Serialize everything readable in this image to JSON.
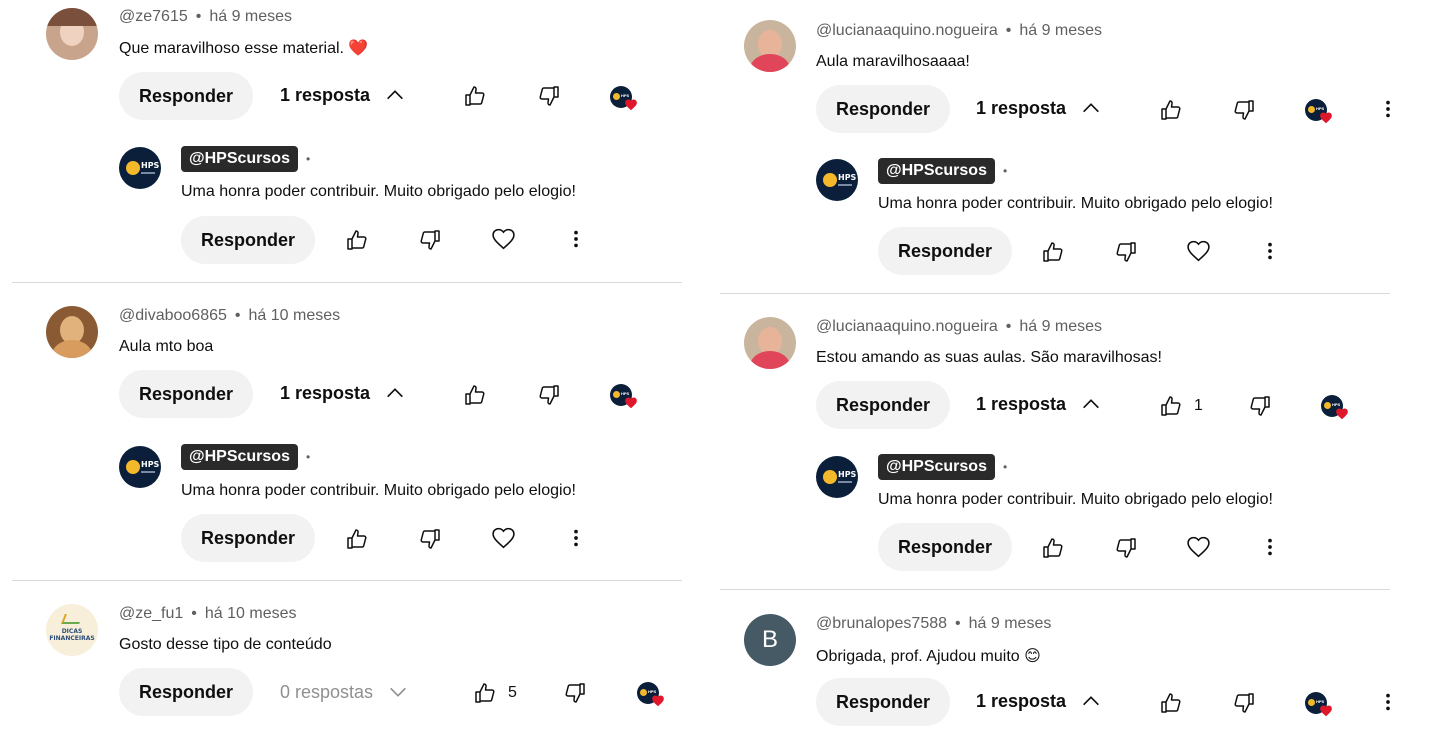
{
  "ui": {
    "reply_label": "Responder",
    "creator_handle": "@HPScursos",
    "badge_separator": "•",
    "meta_separator": "•"
  },
  "left": [
    {
      "author": "@ze7615",
      "time": "há 9 meses",
      "text": "Que maravilhoso esse material. ❤️",
      "replies_label": "1 resposta",
      "likes": "",
      "reply": {
        "text": "Uma honra poder contribuir. Muito obrigado pelo elogio!"
      }
    },
    {
      "author": "@divaboo6865",
      "time": "há 10 meses",
      "text": "Aula mto boa",
      "replies_label": "1 resposta",
      "likes": "",
      "reply": {
        "text": "Uma honra poder contribuir. Muito obrigado pelo elogio!"
      }
    },
    {
      "author": "@ze_fu1",
      "time": "há 10 meses",
      "text": "Gosto desse tipo de conteúdo",
      "replies_label": "0 respostas",
      "likes": "5",
      "avatar_text": "DICAS FINANCEIRAS"
    }
  ],
  "right": [
    {
      "author": "@lucianaaquino.nogueira",
      "time": "há 9 meses",
      "text": "Aula maravilhosaaaa!",
      "replies_label": "1 resposta",
      "likes": "",
      "reply": {
        "text": "Uma honra poder contribuir. Muito obrigado pelo elogio!"
      }
    },
    {
      "author": "@lucianaaquino.nogueira",
      "time": "há 9 meses",
      "text": "Estou amando as suas aulas. São maravilhosas!",
      "replies_label": "1 resposta",
      "likes": "1",
      "reply": {
        "text": "Uma honra poder contribuir. Muito obrigado pelo elogio!"
      }
    },
    {
      "author": "@brunalopes7588",
      "time": "há 9 meses",
      "text": "Obrigada, prof. Ajudou muito 😊",
      "replies_label": "1 resposta",
      "likes": "",
      "avatar_letter": "B"
    }
  ],
  "icons": {
    "like": "thumbs-up-icon",
    "dislike": "thumbs-down-icon",
    "heart": "heart-outline-icon",
    "more": "more-vert-icon",
    "collapse": "chevron-up-icon",
    "expand": "chevron-down-icon",
    "creator_heart": "creator-heart-icon"
  },
  "colors": {
    "pill_bg": "#f2f2f2",
    "meta_text": "#606060",
    "handle_badge_bg": "#2a2a2a",
    "creator_heart": "#e0162b",
    "channel_avatar_bg": "#0b1f3a"
  }
}
